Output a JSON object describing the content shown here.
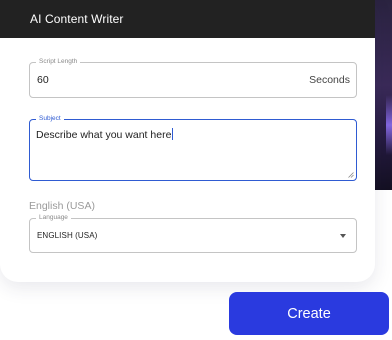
{
  "header": {
    "title": "AI Content Writer"
  },
  "script_length": {
    "label": "Script Length",
    "value": "60",
    "unit": "Seconds"
  },
  "subject": {
    "label": "Subject",
    "value": "Describe what you want here"
  },
  "language": {
    "caption": "English (USA)",
    "label": "Language",
    "selected": "ENGLISH (USA)"
  },
  "actions": {
    "create_label": "Create"
  },
  "colors": {
    "header_bg": "#222222",
    "accent": "#2f5bd2",
    "button": "#2a3adf"
  }
}
